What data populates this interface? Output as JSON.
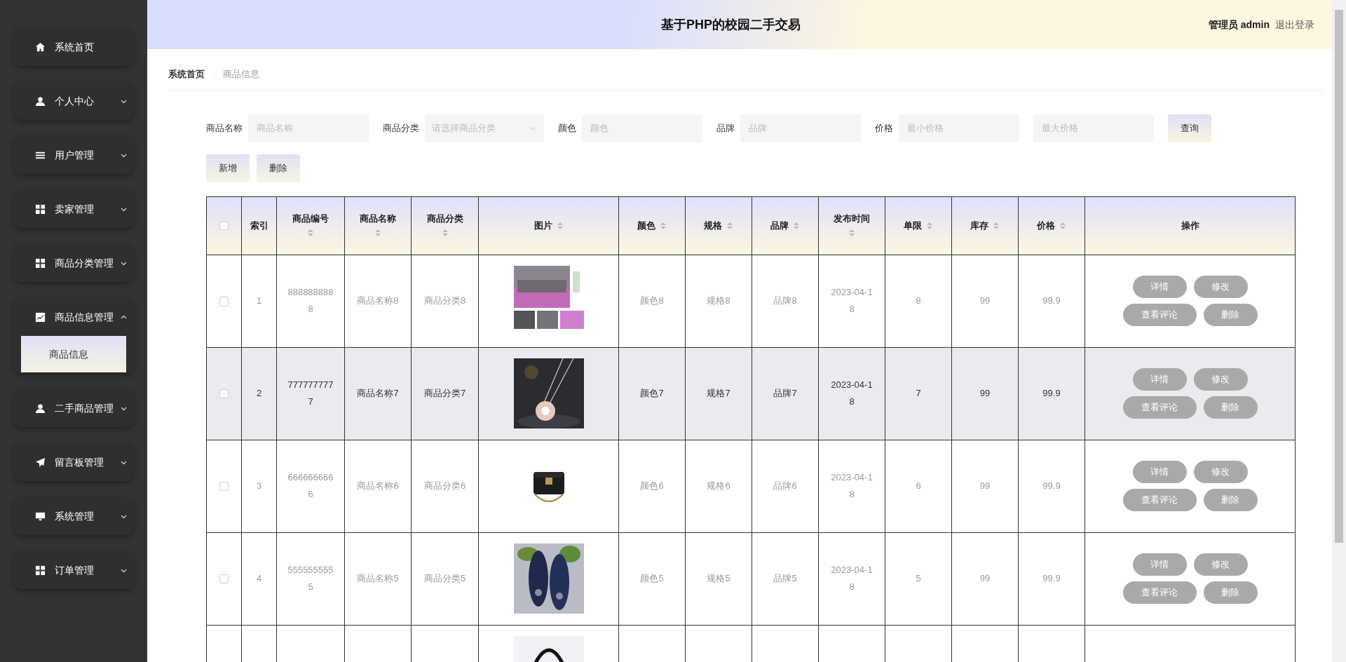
{
  "sidebar": {
    "items": [
      {
        "label": "系统首页"
      },
      {
        "label": "个人中心",
        "expanded": false
      },
      {
        "label": "用户管理",
        "expanded": false
      },
      {
        "label": "卖家管理",
        "expanded": false
      },
      {
        "label": "商品分类管理",
        "expanded": false
      },
      {
        "label": "商品信息管理",
        "expanded": true,
        "children": [
          {
            "label": "商品信息",
            "selected": true
          }
        ]
      },
      {
        "label": "二手商品管理",
        "expanded": false
      },
      {
        "label": "留言板管理",
        "expanded": false
      },
      {
        "label": "系统管理",
        "expanded": false
      },
      {
        "label": "订单管理",
        "expanded": false
      }
    ]
  },
  "header": {
    "title": "基于PHP的校园二手交易",
    "user": "管理员 admin",
    "logout": "退出登录"
  },
  "breadcrumb": [
    "系统首页",
    "商品信息"
  ],
  "filters": [
    {
      "kind": "text",
      "label": "商品名称",
      "placeholder": "商品名称"
    },
    {
      "kind": "select",
      "label": "商品分类",
      "placeholder": "请选择商品分类"
    },
    {
      "kind": "text",
      "label": "颜色",
      "placeholder": "颜色"
    },
    {
      "kind": "text",
      "label": "品牌",
      "placeholder": "品牌"
    },
    {
      "kind": "text",
      "label": "价格",
      "placeholder": "最小价格"
    },
    {
      "kind": "text",
      "placeholder": "最大价格"
    }
  ],
  "search_button": "查询",
  "action_buttons": [
    "新增",
    "删除"
  ],
  "table": {
    "header_checked": false,
    "columns": [
      {
        "label": "索引",
        "sortable": false
      },
      {
        "label": "商品编号",
        "sortable": true
      },
      {
        "label": "商品名称",
        "sortable": true
      },
      {
        "label": "商品分类",
        "sortable": true
      },
      {
        "label": "图片",
        "sortable": true
      },
      {
        "label": "颜色",
        "sortable": true
      },
      {
        "label": "规格",
        "sortable": true
      },
      {
        "label": "品牌",
        "sortable": true
      },
      {
        "label": "发布时间",
        "sortable": true
      },
      {
        "label": "单限",
        "sortable": true
      },
      {
        "label": "库存",
        "sortable": true
      },
      {
        "label": "价格",
        "sortable": true
      },
      {
        "label": "操作",
        "sortable": false
      }
    ],
    "rows": [
      {
        "checked": false,
        "hovered": false,
        "cells": [
          "1",
          "8888888888",
          "商品名称8",
          "商品分类8",
          "",
          "颜色8",
          "规格8",
          "品牌8",
          "2023-04-18",
          "8",
          "99",
          "99.9"
        ],
        "actions": [
          "详情",
          "修改",
          "查看评论",
          "删除"
        ]
      },
      {
        "checked": false,
        "hovered": true,
        "cells": [
          "2",
          "7777777777",
          "商品名称7",
          "商品分类7",
          "",
          "颜色7",
          "规格7",
          "品牌7",
          "2023-04-18",
          "7",
          "99",
          "99.9"
        ],
        "actions": [
          "详情",
          "修改",
          "查看评论",
          "删除"
        ]
      },
      {
        "checked": false,
        "hovered": false,
        "cells": [
          "3",
          "6666666666",
          "商品名称6",
          "商品分类6",
          "",
          "颜色6",
          "规格6",
          "品牌6",
          "2023-04-18",
          "6",
          "99",
          "99.9"
        ],
        "actions": [
          "详情",
          "修改",
          "查看评论",
          "删除"
        ]
      },
      {
        "checked": false,
        "hovered": false,
        "cells": [
          "4",
          "5555555555",
          "商品名称5",
          "商品分类5",
          "",
          "颜色5",
          "规格5",
          "品牌5",
          "2023-04-18",
          "5",
          "99",
          "99.9"
        ],
        "actions": [
          "详情",
          "修改",
          "查看评论",
          "删除"
        ]
      }
    ]
  }
}
